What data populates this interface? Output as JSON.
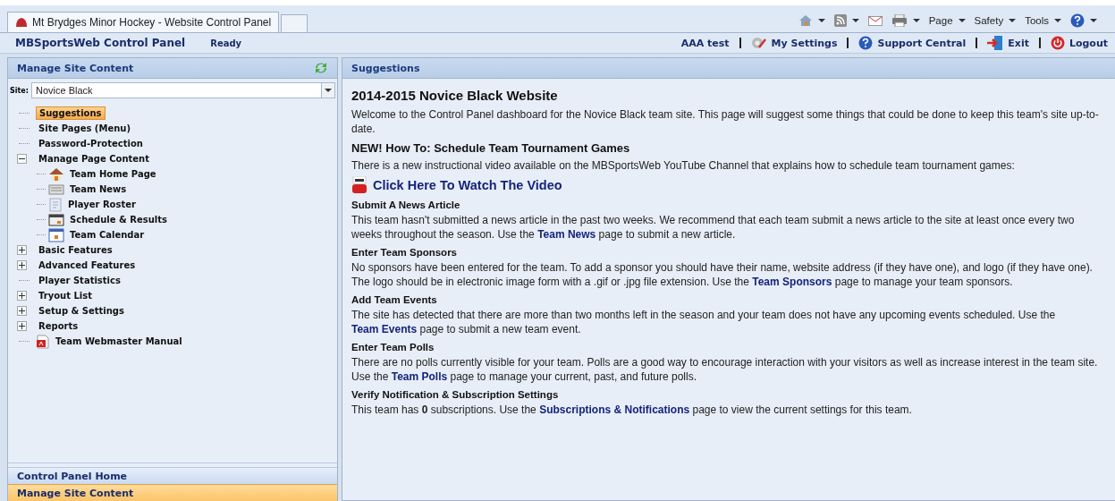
{
  "browser": {
    "tab_title": "Mt Brydges Minor Hockey - Website Control Panel",
    "commands": [
      {
        "kind": "home"
      },
      {
        "kind": "feed"
      },
      {
        "kind": "mail"
      },
      {
        "kind": "print"
      },
      {
        "kind": "menu",
        "label": "Page"
      },
      {
        "kind": "menu",
        "label": "Safety"
      },
      {
        "kind": "menu",
        "label": "Tools"
      },
      {
        "kind": "help"
      }
    ]
  },
  "header": {
    "title": "MBSportsWeb Control Panel",
    "status": "Ready",
    "links": [
      {
        "label": "AAA test"
      },
      {
        "label": "My Settings"
      },
      {
        "label": "Support Central"
      },
      {
        "label": "Exit"
      },
      {
        "label": "Logout"
      }
    ]
  },
  "sidebar": {
    "title": "Manage Site Content",
    "site_label": "Site:",
    "site_value": "Novice Black",
    "tree": [
      {
        "kind": "page",
        "label": "Suggestions",
        "selected": true
      },
      {
        "kind": "page",
        "label": "Site Pages (Menu)",
        "selected": false
      },
      {
        "kind": "page",
        "label": "Password-Protection",
        "selected": false
      },
      {
        "kind": "group",
        "label": "Manage Page Content",
        "selected": false,
        "expanded": true,
        "children": [
          {
            "label": "Team Home Page",
            "selected": false
          },
          {
            "label": "Team News",
            "selected": false
          },
          {
            "label": "Player Roster",
            "selected": false
          },
          {
            "label": "Schedule & Results",
            "selected": false
          },
          {
            "label": "Team Calendar",
            "selected": false
          }
        ]
      },
      {
        "kind": "group",
        "label": "Basic Features",
        "selected": false,
        "expanded": false
      },
      {
        "kind": "group",
        "label": "Advanced Features",
        "selected": false,
        "expanded": false
      },
      {
        "kind": "page",
        "label": "Player Statistics",
        "selected": false
      },
      {
        "kind": "group",
        "label": "Tryout List",
        "selected": false,
        "expanded": false
      },
      {
        "kind": "group",
        "label": "Setup & Settings",
        "selected": false,
        "expanded": false
      },
      {
        "kind": "group",
        "label": "Reports",
        "selected": false,
        "expanded": false
      },
      {
        "kind": "document",
        "label": "Team Webmaster Manual",
        "selected": false
      }
    ],
    "accordion": [
      {
        "label": "Control Panel Home",
        "selected": false
      },
      {
        "label": "Manage Site Content",
        "selected": true
      }
    ]
  },
  "content": {
    "panel_title": "Suggestions",
    "heading": "2014-2015 Novice Black Website",
    "blocks": [
      {
        "kind": "text",
        "parts": [
          {
            "text": "Welcome to the Control Panel dashboard for the Novice Black team site. This page will suggest some things that could be done to keep this team's site up-to-date.",
            "link": false
          }
        ]
      },
      {
        "kind": "subheading",
        "text": "NEW! How To: Schedule Team Tournament Games"
      },
      {
        "kind": "text",
        "parts": [
          {
            "text": "There is a new instructional video available on the MBSportsWeb YouTube Channel that explains how to schedule team tournament games:",
            "link": false
          }
        ]
      },
      {
        "kind": "video",
        "text": "Click Here To Watch The Video"
      },
      {
        "kind": "section",
        "text": "Submit A News Article"
      },
      {
        "kind": "text",
        "parts": [
          {
            "text": "This team hasn't submitted a news article in the past two weeks. We recommend that each team submit a news article to the site at least once every two weeks throughout the season. Use the ",
            "link": false
          },
          {
            "text": "Team News",
            "link": true
          },
          {
            "text": " page to submit a new article.",
            "link": false
          }
        ]
      },
      {
        "kind": "section",
        "text": "Enter Team Sponsors"
      },
      {
        "kind": "text",
        "parts": [
          {
            "text": "No sponsors have been entered for the team. To add a sponsor you should have their name, website address (if they have one), and logo (if they have one). The logo should be in electronic image form with a .gif or .jpg file extension. Use the ",
            "link": false
          },
          {
            "text": "Team Sponsors",
            "link": true
          },
          {
            "text": " page to manage your team sponsors.",
            "link": false
          }
        ]
      },
      {
        "kind": "section",
        "text": "Add Team Events"
      },
      {
        "kind": "text",
        "parts": [
          {
            "text": "The site has detected that there are more than two months left in the season and your team does not have any upcoming events scheduled. Use the ",
            "link": false
          },
          {
            "text": "Team Events",
            "link": true
          },
          {
            "text": " page to submit a new team event.",
            "link": false
          }
        ]
      },
      {
        "kind": "section",
        "text": "Enter Team Polls"
      },
      {
        "kind": "text",
        "parts": [
          {
            "text": "There are no polls currently visible for your team. Polls are a good way to encourage interaction with your visitors as well as increase interest in the team site. Use the ",
            "link": false
          },
          {
            "text": "Team Polls",
            "link": true
          },
          {
            "text": " page to manage your current, past, and future polls.",
            "link": false
          }
        ]
      },
      {
        "kind": "section",
        "text": "Verify Notification & Subscription Settings"
      },
      {
        "kind": "text",
        "parts": [
          {
            "text": "This team has **0** subscriptions. Use the ",
            "link": false
          },
          {
            "text": "Subscriptions & Notifications",
            "link": true
          },
          {
            "text": " page to view the current settings for this team.",
            "link": false
          }
        ]
      }
    ]
  }
}
